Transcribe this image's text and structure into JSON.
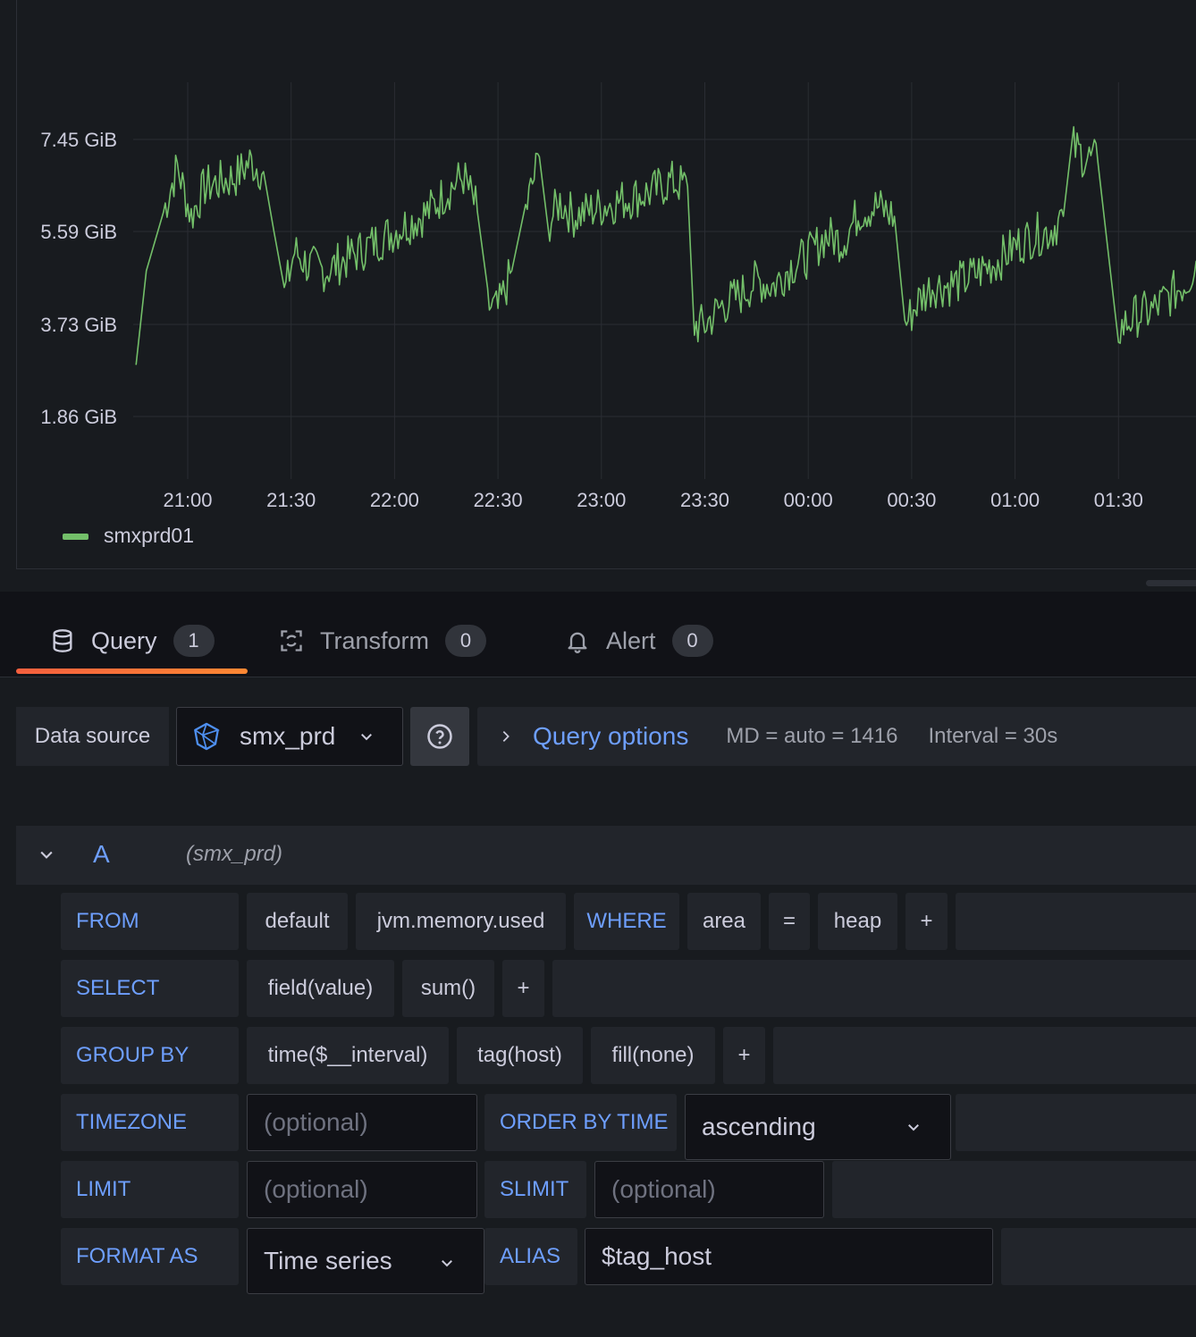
{
  "chart_data": {
    "type": "line",
    "y_ticks": [
      "7.45 GiB",
      "5.59 GiB",
      "3.73 GiB",
      "1.86 GiB"
    ],
    "x_ticks": [
      "21:00",
      "21:30",
      "22:00",
      "22:30",
      "23:00",
      "23:30",
      "00:00",
      "00:30",
      "01:00",
      "01:30"
    ],
    "ylabel_unit": "GiB",
    "series": [
      {
        "name": "smxprd01",
        "color": "#73bf69",
        "time": [
          "20:45",
          "20:48",
          "20:53",
          "20:57",
          "21:01",
          "21:05",
          "21:10",
          "21:14",
          "21:18",
          "21:22",
          "21:25",
          "21:28",
          "21:31",
          "21:35",
          "21:40",
          "21:45",
          "21:50",
          "21:55",
          "22:00",
          "22:05",
          "22:10",
          "22:15",
          "22:20",
          "22:24",
          "22:27",
          "22:30",
          "22:34",
          "22:38",
          "22:42",
          "22:45",
          "22:48",
          "22:52",
          "22:56",
          "23:00",
          "23:05",
          "23:10",
          "23:15",
          "23:20",
          "23:25",
          "23:27",
          "23:30",
          "23:35",
          "23:40",
          "23:45",
          "23:50",
          "23:55",
          "24:00",
          "24:05",
          "24:10",
          "24:15",
          "24:20",
          "24:25",
          "24:28",
          "24:32",
          "24:36",
          "24:40",
          "24:45",
          "24:50",
          "24:55",
          "25:00",
          "25:05",
          "25:10",
          "25:14",
          "25:17",
          "25:20",
          "25:24",
          "25:30",
          "25:35",
          "25:40",
          "25:45",
          "25:50",
          "25:55",
          "25:58"
        ],
        "values": [
          2.9,
          4.8,
          6.0,
          6.9,
          5.9,
          6.5,
          6.6,
          6.7,
          7.0,
          6.8,
          5.6,
          4.3,
          5.2,
          4.9,
          4.8,
          5.0,
          5.2,
          5.4,
          5.6,
          5.8,
          6.0,
          6.4,
          6.7,
          6.0,
          4.1,
          4.0,
          4.8,
          6.0,
          7.1,
          5.8,
          6.2,
          5.9,
          6.0,
          6.1,
          6.2,
          6.3,
          6.4,
          6.6,
          6.5,
          3.7,
          3.7,
          4.1,
          4.3,
          4.6,
          4.5,
          4.9,
          5.1,
          5.5,
          5.4,
          6.0,
          6.1,
          5.9,
          3.7,
          4.2,
          4.5,
          4.5,
          4.6,
          4.8,
          5.0,
          5.3,
          5.5,
          5.6,
          5.9,
          7.3,
          7.1,
          7.0,
          3.6,
          3.9,
          4.0,
          4.3,
          4.6,
          5.4,
          6.0
        ]
      }
    ]
  },
  "legend": {
    "label": "smxprd01"
  },
  "tabs": [
    {
      "label": "Query",
      "count": "1"
    },
    {
      "label": "Transform",
      "count": "0"
    },
    {
      "label": "Alert",
      "count": "0"
    }
  ],
  "datasource": {
    "label": "Data source",
    "selected": "smx_prd",
    "query_options_label": "Query options",
    "md": "MD = auto = 1416",
    "interval": "Interval = 30s"
  },
  "query": {
    "ref_id": "A",
    "ds_hint": "(smx_prd)",
    "from": {
      "keyword": "FROM",
      "policy": "default",
      "measurement": "jvm.memory.used",
      "where_keyword": "WHERE",
      "key": "area",
      "op": "=",
      "value": "heap",
      "plus": "+"
    },
    "select": {
      "keyword": "SELECT",
      "field": "field(value)",
      "agg": "sum()",
      "plus": "+"
    },
    "group_by": {
      "keyword": "GROUP BY",
      "time": "time($__interval)",
      "tag": "tag(host)",
      "fill": "fill(none)",
      "plus": "+"
    },
    "timezone": {
      "keyword": "TIMEZONE",
      "placeholder": "(optional)",
      "order_keyword": "ORDER BY TIME",
      "order_value": "ascending"
    },
    "limit": {
      "keyword": "LIMIT",
      "placeholder": "(optional)",
      "slimit_keyword": "SLIMIT",
      "slimit_placeholder": "(optional)"
    },
    "format": {
      "keyword": "FORMAT AS",
      "value": "Time series",
      "alias_keyword": "ALIAS",
      "alias_value": "$tag_host"
    }
  }
}
